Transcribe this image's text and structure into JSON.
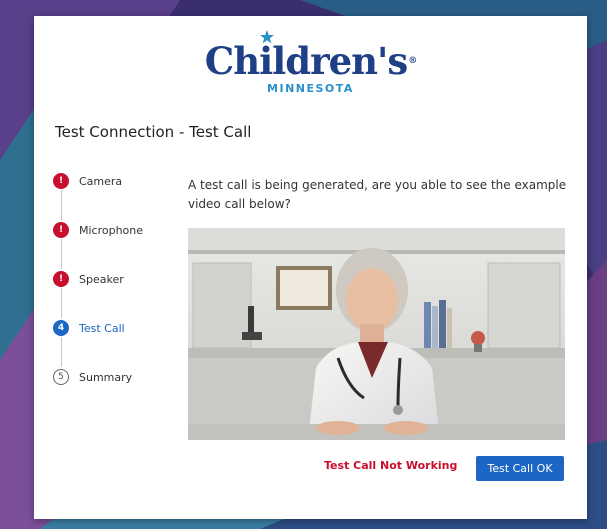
{
  "brand": {
    "name": "Children's",
    "subtitle": "MINNESOTA",
    "registered_mark": "®",
    "primary_color": "#1f3f86",
    "accent_color": "#2b8fc9"
  },
  "page": {
    "title": "Test Connection - Test Call"
  },
  "steps": [
    {
      "label": "Camera",
      "status": "error",
      "badge": "!"
    },
    {
      "label": "Microphone",
      "status": "error",
      "badge": "!"
    },
    {
      "label": "Speaker",
      "status": "error",
      "badge": "!"
    },
    {
      "label": "Test Call",
      "status": "active",
      "badge": "4"
    },
    {
      "label": "Summary",
      "status": "pending",
      "badge": "5"
    }
  ],
  "prompt": "A test call is being generated, are you able to see the example video call below?",
  "video": {
    "icon": "doctor-video-preview"
  },
  "actions": {
    "not_working_label": "Test Call Not Working",
    "ok_label": "Test Call OK"
  },
  "colors": {
    "error": "#c8102e",
    "active": "#1c66c4"
  }
}
